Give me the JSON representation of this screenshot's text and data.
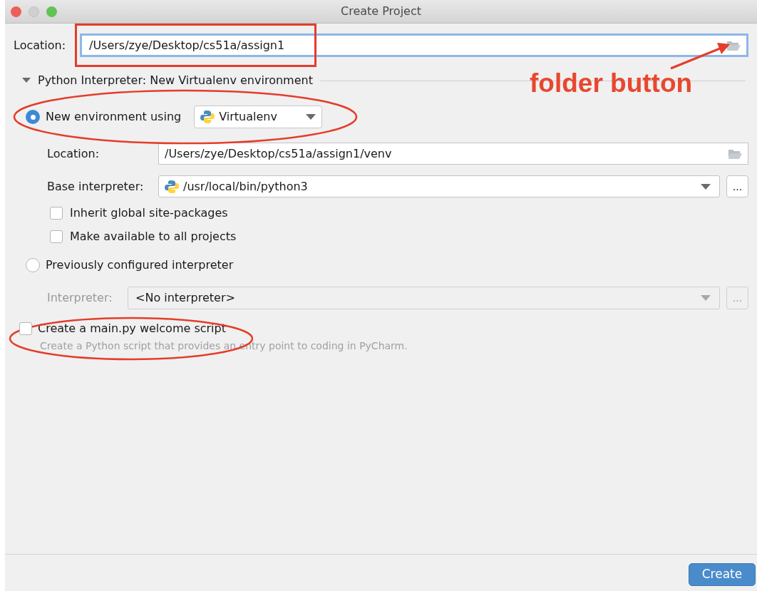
{
  "window": {
    "title": "Create Project"
  },
  "location": {
    "label": "Location:",
    "value": "/Users/zye/Desktop/cs51a/assign1",
    "focused": true
  },
  "section": {
    "title": "Python Interpreter: New Virtualenv environment",
    "expanded": true
  },
  "interpreter_options": [
    {
      "label": "New environment using",
      "selected": true,
      "tool": "Virtualenv"
    },
    {
      "label": "Previously configured interpreter",
      "selected": false
    }
  ],
  "new_environment": {
    "location": {
      "label": "Location:",
      "value": "/Users/zye/Desktop/cs51a/assign1/venv"
    },
    "base_interpreter": {
      "label": "Base interpreter:",
      "value": "/usr/local/bin/python3",
      "more": "..."
    },
    "checkboxes": [
      {
        "label": "Inherit global site-packages",
        "checked": false
      },
      {
        "label": "Make available to all projects",
        "checked": false
      }
    ]
  },
  "existing_interpreter": {
    "label": "Interpreter:",
    "value": "<No interpreter>",
    "more": "...",
    "disabled": true
  },
  "welcome_script": {
    "label": "Create a main.py welcome script",
    "checked": false,
    "description": "Create a Python script that provides an entry point to coding in PyCharm."
  },
  "create_button": "Create",
  "annotation": {
    "text": "folder button"
  }
}
